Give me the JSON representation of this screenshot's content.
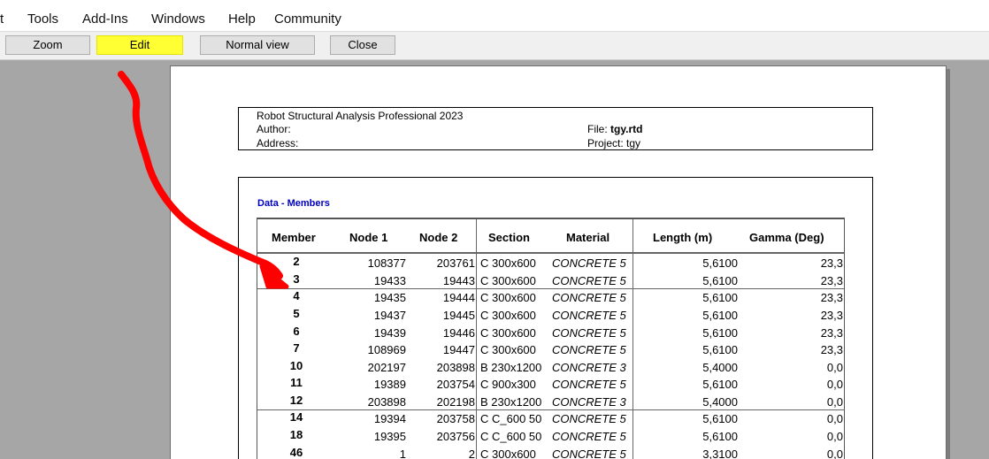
{
  "menu": [
    "t",
    "Tools",
    "Add-Ins",
    "Windows",
    "Help",
    "Community"
  ],
  "toolbar": {
    "zoom": "Zoom",
    "edit": "Edit",
    "normal_view": "Normal view",
    "close": "Close"
  },
  "header": {
    "product": "Robot Structural Analysis Professional 2023",
    "author_label": "Author:",
    "address_label": "Address:",
    "file_label": "File:",
    "file_value": "tgy.rtd",
    "project_label": "Project:",
    "project_value": "tgy"
  },
  "section_title": "Data - Members",
  "table": {
    "columns": [
      "Member",
      "Node 1",
      "Node 2",
      "Section",
      "Material",
      "Length (m)",
      "Gamma (Deg)"
    ],
    "rows": [
      [
        "2",
        "108377",
        "203761",
        "C 300x600",
        "CONCRETE 5",
        "5,6100",
        "23,3"
      ],
      [
        "3",
        "19433",
        "19443",
        "C 300x600",
        "CONCRETE 5",
        "5,6100",
        "23,3"
      ],
      [
        "4",
        "19435",
        "19444",
        "C 300x600",
        "CONCRETE 5",
        "5,6100",
        "23,3"
      ],
      [
        "5",
        "19437",
        "19445",
        "C 300x600",
        "CONCRETE 5",
        "5,6100",
        "23,3"
      ],
      [
        "6",
        "19439",
        "19446",
        "C 300x600",
        "CONCRETE 5",
        "5,6100",
        "23,3"
      ],
      [
        "7",
        "108969",
        "19447",
        "C 300x600",
        "CONCRETE 5",
        "5,6100",
        "23,3"
      ],
      [
        "10",
        "202197",
        "203898",
        "B 230x1200",
        "CONCRETE 3",
        "5,4000",
        "0,0"
      ],
      [
        "11",
        "19389",
        "203754",
        "C 900x300",
        "CONCRETE 5",
        "5,6100",
        "0,0"
      ],
      [
        "12",
        "203898",
        "202198",
        "B 230x1200",
        "CONCRETE 3",
        "5,4000",
        "0,0"
      ],
      [
        "14",
        "19394",
        "203758",
        "C C_600 50",
        "CONCRETE 5",
        "5,6100",
        "0,0"
      ],
      [
        "18",
        "19395",
        "203756",
        "C C_600 50",
        "CONCRETE 5",
        "5,6100",
        "0,0"
      ],
      [
        "46",
        "1",
        "2",
        "C 300x600",
        "CONCRETE 5",
        "3,3100",
        "0,0"
      ]
    ]
  },
  "colors": {
    "edit_highlight": "#ffff33",
    "annotation_arrow": "#ff0000",
    "section_title": "#0000c0"
  }
}
